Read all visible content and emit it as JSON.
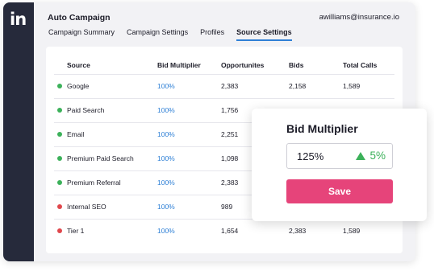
{
  "app": {
    "title": "Auto Campaign",
    "user_email": "awilliams@insurance.io",
    "logo_text": "in",
    "logo_color": "#ffffff",
    "sidebar_color": "#262a3b"
  },
  "tabs": [
    {
      "label": "Campaign Summary",
      "active": false
    },
    {
      "label": "Campaign Settings",
      "active": false
    },
    {
      "label": "Profiles",
      "active": false
    },
    {
      "label": "Source Settings",
      "active": true
    }
  ],
  "table": {
    "headers": [
      "Source",
      "Bid Multiplier",
      "Opportunites",
      "Bids",
      "Total Calls"
    ],
    "rows": [
      {
        "status": "green",
        "source": "Google",
        "bid_multiplier": "100%",
        "opportunities": "2,383",
        "bids": "2,158",
        "total_calls": "1,589"
      },
      {
        "status": "green",
        "source": "Paid Search",
        "bid_multiplier": "100%",
        "opportunities": "1,756",
        "bids": "",
        "total_calls": ""
      },
      {
        "status": "green",
        "source": "Email",
        "bid_multiplier": "100%",
        "opportunities": "2,251",
        "bids": "",
        "total_calls": ""
      },
      {
        "status": "green",
        "source": "Premium Paid Search",
        "bid_multiplier": "100%",
        "opportunities": "1,098",
        "bids": "",
        "total_calls": ""
      },
      {
        "status": "green",
        "source": "Premium Referral",
        "bid_multiplier": "100%",
        "opportunities": "2,383",
        "bids": "",
        "total_calls": ""
      },
      {
        "status": "red",
        "source": "Internal SEO",
        "bid_multiplier": "100%",
        "opportunities": "989",
        "bids": "",
        "total_calls": ""
      },
      {
        "status": "red",
        "source": "Tier 1",
        "bid_multiplier": "100%",
        "opportunities": "1,654",
        "bids": "2,383",
        "total_calls": "1,589"
      }
    ]
  },
  "colors": {
    "status_green": "#3cb15a",
    "status_red": "#e0474c",
    "link_blue": "#2f80d6",
    "accent_pink": "#e6447a"
  },
  "bid_card": {
    "title": "Bid Multiplier",
    "value": "125%",
    "change": "5%",
    "change_icon": "arrow-up-icon",
    "save_label": "Save"
  }
}
